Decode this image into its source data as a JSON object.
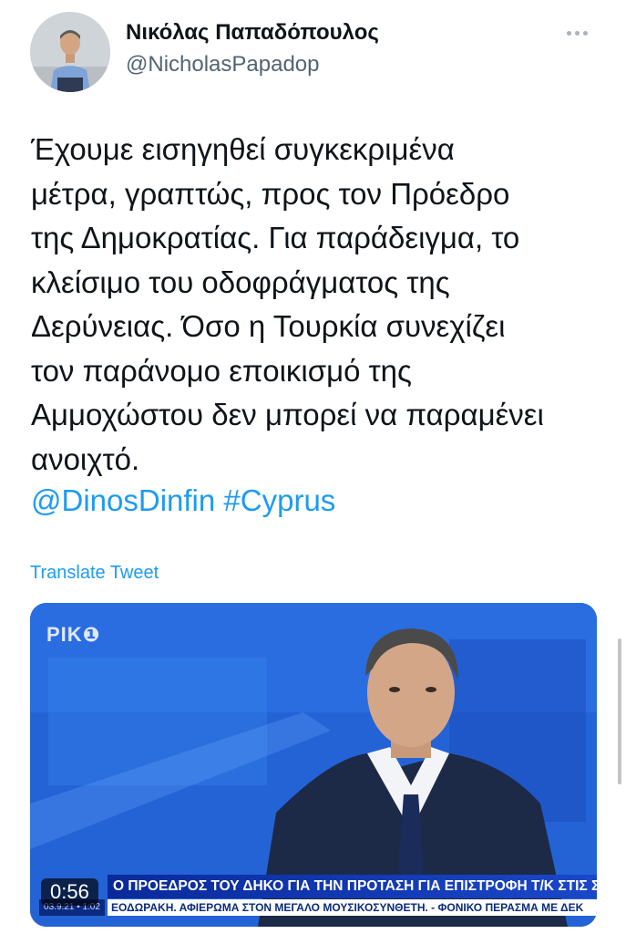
{
  "author": {
    "name": "Νικόλας Παπαδόπουλος",
    "handle": "@NicholasPapadop",
    "avatar_icon": "profile-photo"
  },
  "more_icon": "more-horizontal-icon",
  "tweet": {
    "lines": [
      "Έχουμε εισηγηθεί συγκεκριμένα",
      "μέτρα, γραπτώς, προς τον Πρόεδρο",
      "της Δημοκρατίας. Για παράδειγμα, το",
      "κλείσιμο του οδοφράγματος της",
      "Δερύνειας. Όσο η Τουρκία συνεχίζει",
      "τον παράνομο εποικισμό της",
      "Αμμοχώστου δεν μπορεί να παραμένει",
      "ανοιχτό."
    ],
    "mention": "@DinosDinfin",
    "hashtag": "#Cyprus"
  },
  "translate_label": "Translate Tweet",
  "video": {
    "channel_logo": "ΡΙΚ❶",
    "duration": "0:56",
    "headline": "Ο ΠΡΟΕΔΡΟΣ ΤΟΥ ΔΗΚΟ ΓΙΑ ΤΗΝ ΠΡΟΤΑΣΗ ΓΙΑ ΕΠΙΣΤΡΟΦΗ Τ/Κ ΣΤΙΣ ΣΥΝΤΑΓΜΑΤΙΚΕΣ ΔΟΜΕΣ",
    "ticker": "ΕΟΔΩΡΑΚΗ. ΑΦΙΕΡΩΜΑ ΣΤΟΝ ΜΕΓΑΛΟ ΜΟΥΣΙΚΟΣΥΝΘΕΤΗ.  - ΦΟΝΙΚΟ ΠΕΡΑΣΜΑ ΜΕ ΔΕΚ",
    "timestamp": "03.9.21 • 1:02"
  },
  "colors": {
    "link": "#1d9bf0",
    "text": "#0f1419",
    "secondary": "#536471"
  }
}
